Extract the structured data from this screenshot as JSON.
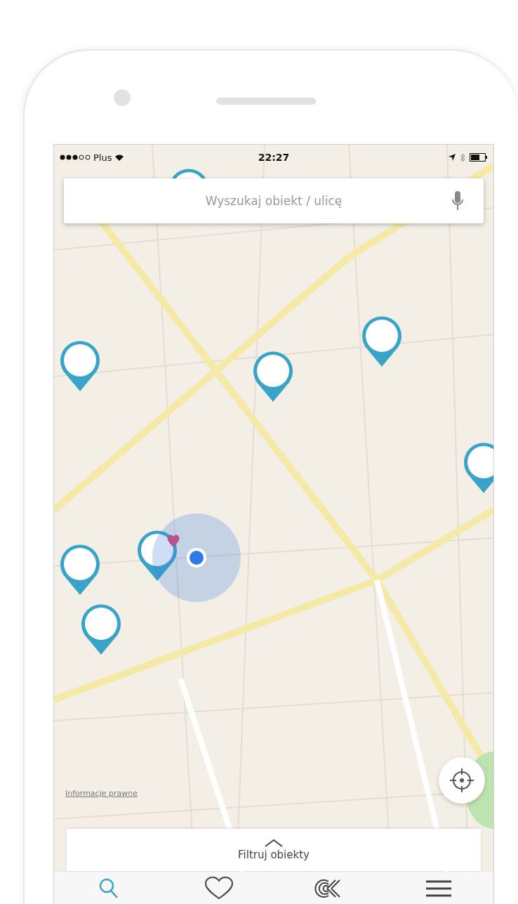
{
  "status_bar": {
    "carrier": "Plus",
    "time": "22:27"
  },
  "search": {
    "placeholder": "Wyszukaj obiekt / ulicę"
  },
  "map": {
    "legal_link": "Informacje prawne"
  },
  "filter_panel": {
    "label": "Filtruj obiekty"
  },
  "tab_bar": [
    {
      "kind": "search",
      "selected": true
    },
    {
      "kind": "favorites",
      "selected": false
    },
    {
      "kind": "logo",
      "selected": false
    },
    {
      "kind": "menu",
      "selected": false
    }
  ]
}
